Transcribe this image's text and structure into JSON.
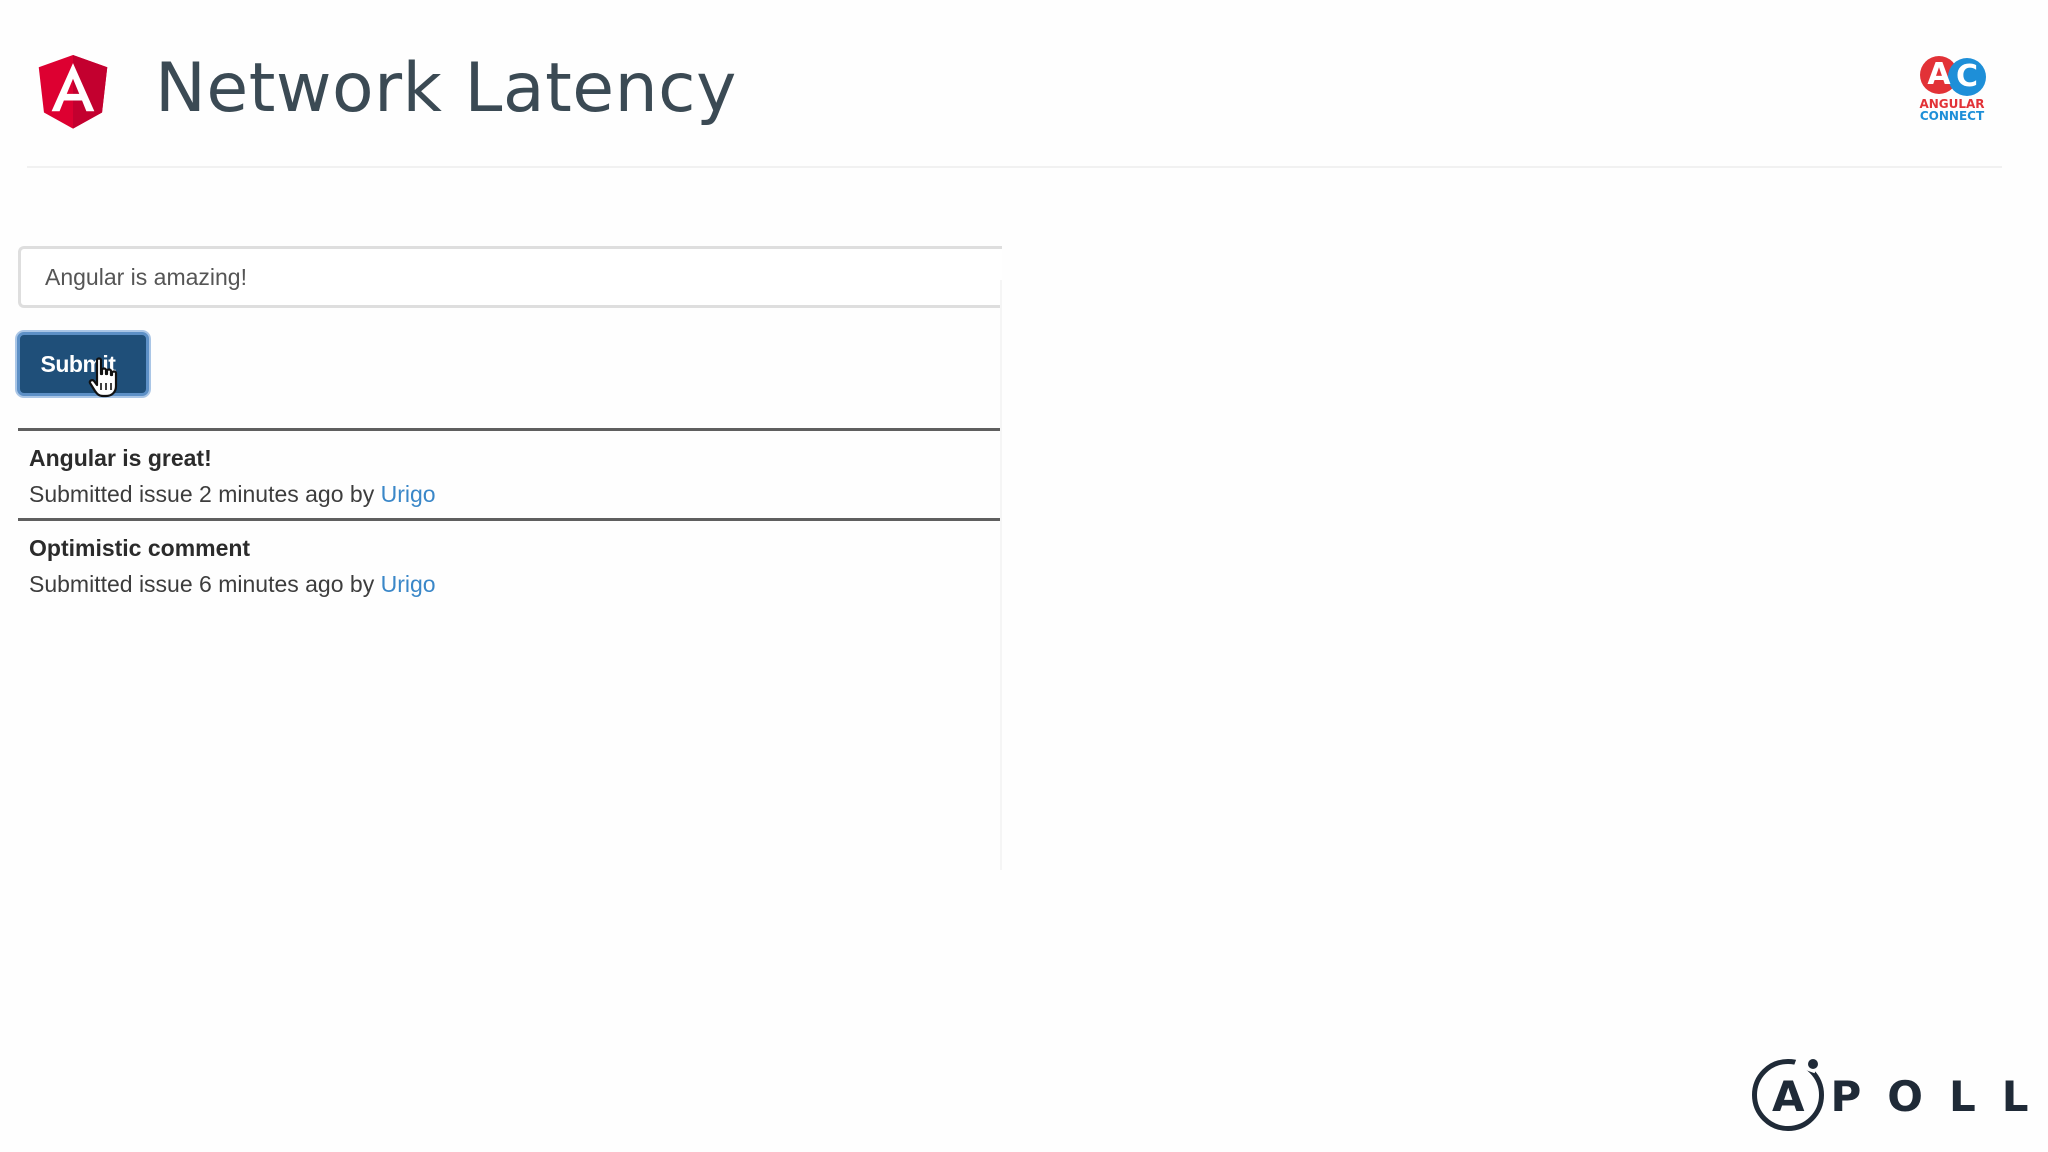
{
  "slide": {
    "title": "Network Latency"
  },
  "sponsor_logo": {
    "letters_left": "A",
    "letters_right": "C",
    "line1": "ANGULAR",
    "line2": "CONNECT"
  },
  "demo": {
    "input": {
      "value": "Angular is amazing!",
      "placeholder": ""
    },
    "submit_label": "Submit",
    "comments": [
      {
        "title": "Angular is great!",
        "meta_prefix": "Submitted issue 2 minutes ago by",
        "author": "Urigo"
      },
      {
        "title": "Optimistic comment",
        "meta_prefix": "Submitted issue 6 minutes ago by",
        "author": "Urigo"
      }
    ]
  },
  "footer_logo": {
    "word": "APOLLO"
  },
  "colors": {
    "angular_red": "#dd0031",
    "title_text": "#3b4a54",
    "button_blue": "#1f4f79",
    "link_blue": "#3a87c8",
    "apollo_dark": "#1f2a37"
  },
  "icons": {
    "angular_logo": "angular-shield-icon",
    "cursor": "hand-pointer-icon"
  }
}
